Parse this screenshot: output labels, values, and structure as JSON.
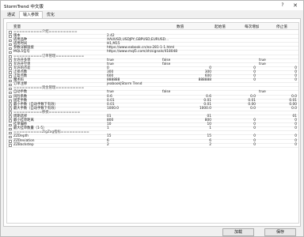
{
  "window": {
    "title": "StormTrend 中文版",
    "help": "?",
    "close": "✕"
  },
  "tabs": [
    "通试",
    "输入参数",
    "优化"
  ],
  "header": {
    "variable": "变量",
    "value": "数值",
    "start": "起始值",
    "step": "每次增加",
    "stop": "停止值"
  },
  "rows": [
    {
      "section": true,
      "name": "==========介绍=========="
    },
    {
      "name": "版本",
      "value": "2.42"
    },
    {
      "name": "适用品种",
      "value": "XAUUSD,USDJPY,GBPUSD,EURUSD..."
    },
    {
      "name": "适用时间",
      "value": "H1,M15"
    },
    {
      "name": "参数详解链接",
      "value": "https://www.eabook.cn/ea-281-1-1.html"
    },
    {
      "name": "MQL5信号",
      "value": "https://www.mql5.com/zh/signals/418048"
    },
    {
      "section": true,
      "name": "==========订单管理=========="
    },
    {
      "name": "允许开多单",
      "value": "true",
      "start": "false",
      "stop": "true"
    },
    {
      "name": "允许开空单",
      "value": "true",
      "start": "false",
      "stop": "true"
    },
    {
      "name": "允许的点差",
      "value": "0",
      "start": "0",
      "step": "0",
      "stop": "0"
    },
    {
      "name": "止损点数",
      "value": "300",
      "start": "300",
      "step": "0",
      "stop": "0"
    },
    {
      "name": "止盈点数",
      "value": "600",
      "start": "600",
      "step": "0",
      "stop": "0"
    },
    {
      "name": "魔术码",
      "value": "888888",
      "start": "888888",
      "step": "0",
      "stop": "0"
    },
    {
      "name": "订单注释",
      "value": "jeabook|Storm Trend"
    },
    {
      "section": true,
      "name": "==========资金管理=========="
    },
    {
      "name": "自动手数",
      "value": "true",
      "start": "false",
      "stop": "true"
    },
    {
      "name": "风险系数",
      "value": "0.6",
      "start": "0.6",
      "step": "0.0",
      "stop": "0.0"
    },
    {
      "name": "固定手数",
      "value": "0.01",
      "start": "0.01",
      "step": "0.01",
      "stop": "0.01"
    },
    {
      "name": "最小手数（自动手数下有效）",
      "value": "0.01",
      "start": "0.01",
      "step": "0.00",
      "stop": "0.00"
    },
    {
      "name": "最大手数（自动手数下有效）",
      "value": "1000.0",
      "start": "1000.0",
      "step": "0.0",
      "stop": "0.0"
    },
    {
      "section": true,
      "name": "==========移损==========="
    },
    {
      "name": "周期选择",
      "value": "01",
      "start": "01",
      "stop": "01"
    },
    {
      "name": "最小挂单距离",
      "value": "800",
      "start": "800",
      "step": "0",
      "stop": "0"
    },
    {
      "name": "挂单偏移",
      "value": "10",
      "start": "10",
      "step": "0",
      "stop": "0"
    },
    {
      "name": "最大挂单数量（1-5）",
      "value": "1",
      "start": "1",
      "step": "0",
      "stop": "0"
    },
    {
      "section": true,
      "name": "==========ZigZag指标=========="
    },
    {
      "name": "ZZDepth",
      "value": "15",
      "start": "15",
      "step": "0",
      "stop": "0"
    },
    {
      "name": "ZZDeviation",
      "value": "6",
      "start": "6",
      "step": "0",
      "stop": "0"
    },
    {
      "name": "ZZBackstep",
      "value": "2",
      "start": "2",
      "step": "0",
      "stop": "0"
    }
  ],
  "buttons": {
    "load": "加载",
    "save": "保存"
  }
}
